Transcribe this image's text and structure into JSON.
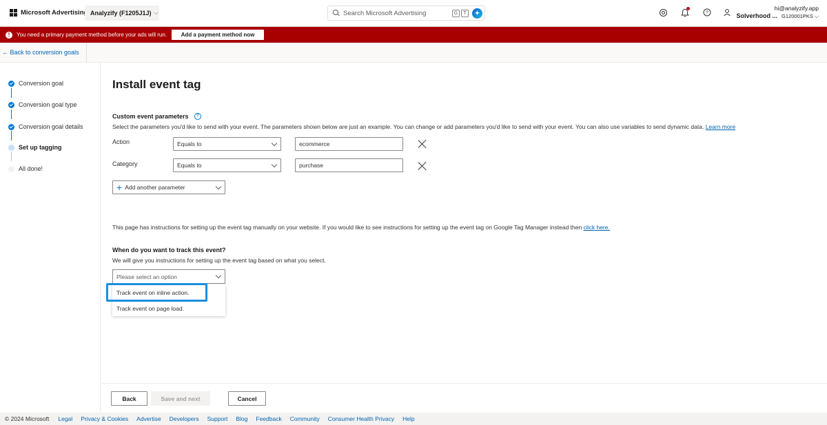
{
  "header": {
    "brand": "Microsoft Advertising",
    "account": "Analyzify (F1205J1J)",
    "search_placeholder": "Search Microsoft Advertising",
    "kbd_g": "G",
    "kbd_t": "T",
    "user_email": "hi@analyzify.app",
    "user_name": "Solverhood ...",
    "user_id": "G120001PKS"
  },
  "alert": {
    "message": "You need a primary payment method before your ads will run.",
    "button": "Add a payment method now",
    "color": "#a80000"
  },
  "nav": {
    "back_link": "← Back to conversion goals"
  },
  "stepper": {
    "steps": [
      {
        "label": "Conversion goal",
        "state": "done"
      },
      {
        "label": "Conversion goal type",
        "state": "done"
      },
      {
        "label": "Conversion goal details",
        "state": "done"
      },
      {
        "label": "Set up tagging",
        "state": "current"
      },
      {
        "label": "All done!",
        "state": "todo"
      }
    ]
  },
  "main": {
    "title": "Install event tag",
    "params_title": "Custom event parameters",
    "params_desc": "Select the parameters you'd like to send with your event. The parameters shown below are just an example. You can change or add parameters you'd like to send with your event. You can also use variables to send dynamic data.",
    "learn_more": "Learn more",
    "params": [
      {
        "label": "Action",
        "operator": "Equals to",
        "value": "ecommerce"
      },
      {
        "label": "Category",
        "operator": "Equals to",
        "value": "purchase"
      }
    ],
    "add_param": "Add another parameter",
    "info_text": "This page has instructions for setting up the event tag manually on your website. If you would like to see instructions for setting up the event tag on Google Tag Manager instead then",
    "click_here": "click here.",
    "track_title": "When do you want to track this event?",
    "track_desc": "We will give you instructions for setting up the event tag based on what you select.",
    "track_placeholder": "Please select an option",
    "track_options": [
      "Track event on inline action.",
      "Track event on page load."
    ]
  },
  "actions": {
    "back": "Back",
    "next": "Save and next",
    "cancel": "Cancel"
  },
  "footer": {
    "copyright": "© 2024 Microsoft",
    "links": [
      "Legal",
      "Privacy & Cookies",
      "Advertise",
      "Developers",
      "Support",
      "Blog",
      "Feedback",
      "Community",
      "Consumer Health Privacy",
      "Help"
    ]
  }
}
